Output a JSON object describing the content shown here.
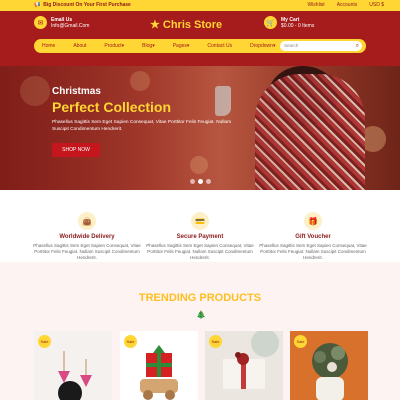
{
  "topbar": {
    "promo": "Big Discount On Your First Purchase",
    "links": [
      "Wishlist",
      "Accounts",
      "USD $"
    ]
  },
  "header": {
    "email_label": "Email Us",
    "email_value": "Info@Gmail.Com",
    "logo": "Chris Store",
    "cart_label": "My Cart",
    "cart_value": "$0.00 - 0 Items"
  },
  "nav": {
    "items": [
      "Home",
      "About",
      "Product",
      "Blog",
      "Pages",
      "Contact Us",
      "Dropdown"
    ],
    "search_placeholder": "Search"
  },
  "hero": {
    "subtitle": "Christmas",
    "title": "Perfect Collection",
    "text": "Phasellus Sagittis Sem Eget Sapien Consequat, Vitae Porttitor Felis Feugiat. Nullam Suscipit Condimentum Hendrerit.",
    "button": "SHOP NOW"
  },
  "features": [
    {
      "title": "Worldwide Delivery",
      "text": "Phasellus Sagittis Sem Eget Sapien Consequat, Vitae Porttitor Felis Feugiat. Nullam Suscipit Condimentum Hendrerit."
    },
    {
      "title": "Secure Payment",
      "text": "Phasellus Sagittis Sem Eget Sapien Consequat, Vitae Porttitor Felis Feugiat. Nullam Suscipit Condimentum Hendrerit."
    },
    {
      "title": "Gift Voucher",
      "text": "Phasellus Sagittis Sem Eget Sapien Consequat, Vitae Porttitor Felis Feugiat. Nullam Suscipit Condimentum Hendrerit."
    }
  ],
  "trending": {
    "title": "TRENDING PRODUCTS",
    "badge": "Sale"
  },
  "colors": {
    "brand_red": "#a61b1b",
    "accent_yellow": "#ffd633",
    "button_red": "#c4161c"
  }
}
